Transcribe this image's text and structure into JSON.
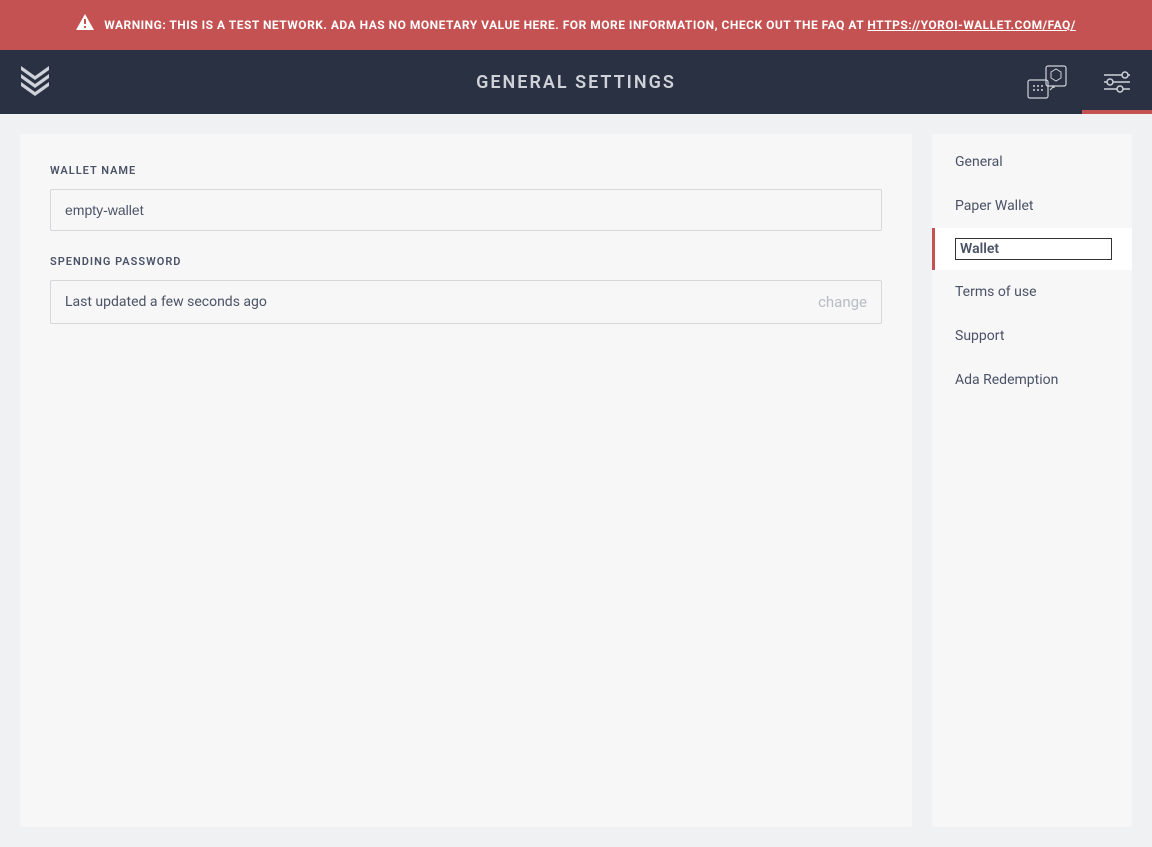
{
  "warning": {
    "prefix": "WARNING: THIS IS A TEST NETWORK. ADA HAS NO MONETARY VALUE HERE. FOR MORE INFORMATION, CHECK OUT THE FAQ AT ",
    "link_text": "HTTPS://YOROI-WALLET.COM/FAQ/"
  },
  "header": {
    "title": "GENERAL SETTINGS"
  },
  "form": {
    "wallet_name_label": "WALLET NAME",
    "wallet_name_value": "empty-wallet",
    "spending_password_label": "SPENDING PASSWORD",
    "spending_password_status": "Last updated a few seconds ago",
    "change_label": "change"
  },
  "sidebar": {
    "items": [
      {
        "label": "General",
        "active": false
      },
      {
        "label": "Paper Wallet",
        "active": false
      },
      {
        "label": "Wallet",
        "active": true
      },
      {
        "label": "Terms of use",
        "active": false
      },
      {
        "label": "Support",
        "active": false
      },
      {
        "label": "Ada Redemption",
        "active": false
      }
    ]
  }
}
